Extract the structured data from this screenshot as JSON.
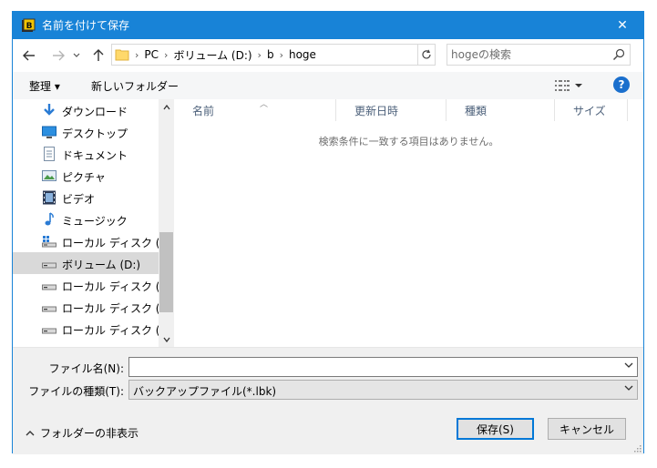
{
  "window": {
    "title": "名前を付けて保存",
    "close_glyph": "✕"
  },
  "address": {
    "crumbs": [
      "PC",
      "ボリューム (D:)",
      "b",
      "hoge"
    ],
    "separator": "›"
  },
  "search": {
    "placeholder": "hogeの検索"
  },
  "toolbar": {
    "organize": "整理 ▾",
    "new_folder": "新しいフォルダー",
    "help": "?"
  },
  "nav": {
    "items": [
      {
        "label": "ダウンロード",
        "icon": "download-icon"
      },
      {
        "label": "デスクトップ",
        "icon": "desktop-icon"
      },
      {
        "label": "ドキュメント",
        "icon": "documents-icon"
      },
      {
        "label": "ピクチャ",
        "icon": "pictures-icon"
      },
      {
        "label": "ビデオ",
        "icon": "videos-icon"
      },
      {
        "label": "ミュージック",
        "icon": "music-icon"
      },
      {
        "label": "ローカル ディスク (C:)",
        "icon": "system-drive-icon"
      },
      {
        "label": "ボリューム (D:)",
        "icon": "drive-icon",
        "selected": true
      },
      {
        "label": "ローカル ディスク (E:)",
        "icon": "drive-icon"
      },
      {
        "label": "ローカル ディスク (F:)",
        "icon": "drive-icon"
      },
      {
        "label": "ローカル ディスク (G:)",
        "icon": "drive-icon"
      }
    ]
  },
  "filelist": {
    "columns": [
      "名前",
      "更新日時",
      "種類",
      "サイズ"
    ],
    "empty_message": "検索条件に一致する項目はありません。"
  },
  "form": {
    "filename_label": "ファイル名(N):",
    "filename_value": "",
    "filetype_label": "ファイルの種類(T):",
    "filetype_value": "バックアップファイル(*.lbk)"
  },
  "footer": {
    "hide_folders": "フォルダーの非表示",
    "save": "保存(S)",
    "cancel": "キャンセル"
  },
  "colors": {
    "titlebar": "#1883d7",
    "accent": "#0078d7",
    "selected_row": "#d9d9d9"
  }
}
